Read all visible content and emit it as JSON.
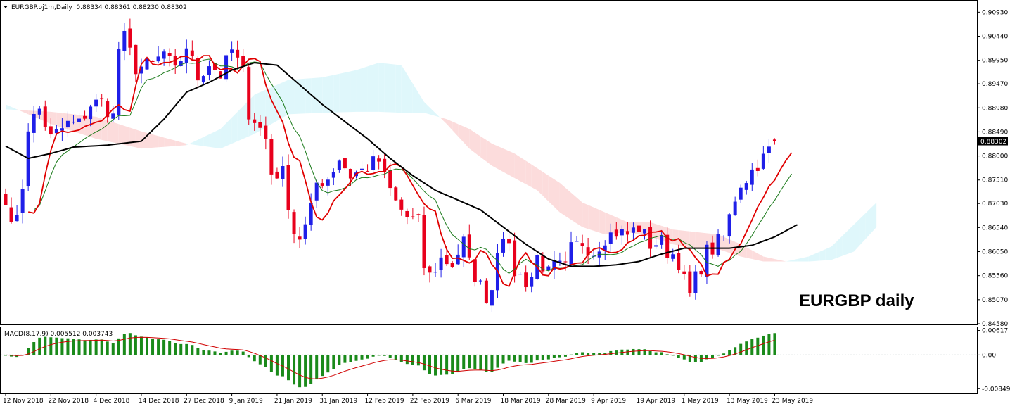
{
  "colors": {
    "bull": "#1f1fe8",
    "bear": "#e8001c",
    "ma_fast": "#e00000",
    "ma_mid": "#1a7a1a",
    "ma_slow": "#000000",
    "cloud_bull": "#dff7fb",
    "cloud_bear": "#fcdcdc",
    "macd_hist": "#1a8a1a",
    "macd_signal": "#d00000",
    "price_line": "#8a9aa8",
    "current_price_label_bg": "#000000"
  },
  "main_header": {
    "symbol_info": "EURGBP.oj1m,Daily  0.88334 0.88361 0.88230 0.88302"
  },
  "macd_header": {
    "info": "MACD(8,17,9) 0.005512 0.003743"
  },
  "annotation": {
    "text": "EURGBP daily"
  },
  "chart_data": [
    {
      "type": "candlestick",
      "title": "EURGBP.oj1m,Daily",
      "symbol": "EURGBP.oj1m",
      "timeframe": "Daily",
      "last_bar_ohlc": {
        "open": 0.88334,
        "high": 0.88361,
        "low": 0.8823,
        "close": 0.88302
      },
      "current_price": {
        "value": 0.88302,
        "label": "0.88302"
      },
      "ylim": [
        0.8458,
        0.9115
      ],
      "y_ticks": [
        {
          "value": 0.9093,
          "label": "0.90930"
        },
        {
          "value": 0.9044,
          "label": "0.90440"
        },
        {
          "value": 0.8995,
          "label": "0.89950"
        },
        {
          "value": 0.8947,
          "label": "0.89470"
        },
        {
          "value": 0.8898,
          "label": "0.88980"
        },
        {
          "value": 0.8849,
          "label": "0.88490"
        },
        {
          "value": 0.88,
          "label": "0.88000"
        },
        {
          "value": 0.8751,
          "label": "0.87510"
        },
        {
          "value": 0.8703,
          "label": "0.87030"
        },
        {
          "value": 0.8654,
          "label": "0.86540"
        },
        {
          "value": 0.8605,
          "label": "0.86050"
        },
        {
          "value": 0.8556,
          "label": "0.85560"
        },
        {
          "value": 0.8507,
          "label": "0.85070"
        },
        {
          "value": 0.8458,
          "label": "0.84580"
        }
      ],
      "x_ticks": [
        {
          "bar": 0,
          "label": "12 Nov 2018"
        },
        {
          "bar": 8,
          "label": "22 Nov 2018"
        },
        {
          "bar": 16,
          "label": "4 Dec 2018"
        },
        {
          "bar": 24,
          "label": "14 Dec 2018"
        },
        {
          "bar": 32,
          "label": "27 Dec 2018"
        },
        {
          "bar": 40,
          "label": "9 Jan 2019"
        },
        {
          "bar": 48,
          "label": "21 Jan 2019"
        },
        {
          "bar": 56,
          "label": "31 Jan 2019"
        },
        {
          "bar": 64,
          "label": "12 Feb 2019"
        },
        {
          "bar": 72,
          "label": "22 Feb 2019"
        },
        {
          "bar": 80,
          "label": "6 Mar 2019"
        },
        {
          "bar": 88,
          "label": "18 Mar 2019"
        },
        {
          "bar": 96,
          "label": "28 Mar 2019"
        },
        {
          "bar": 104,
          "label": "9 Apr 2019"
        },
        {
          "bar": 112,
          "label": "19 Apr 2019"
        },
        {
          "bar": 120,
          "label": "1 May 2019"
        },
        {
          "bar": 128,
          "label": "13 May 2019"
        },
        {
          "bar": 136,
          "label": "23 May 2019"
        }
      ],
      "close_waypoints": [
        [
          0,
          0.87
        ],
        [
          2,
          0.8665
        ],
        [
          3,
          0.874
        ],
        [
          4,
          0.886
        ],
        [
          6,
          0.8895
        ],
        [
          8,
          0.8835
        ],
        [
          11,
          0.8865
        ],
        [
          13,
          0.8865
        ],
        [
          15,
          0.8905
        ],
        [
          17,
          0.891
        ],
        [
          19,
          0.888
        ],
        [
          20,
          0.902
        ],
        [
          21,
          0.904
        ],
        [
          23,
          0.898
        ],
        [
          26,
          0.8985
        ],
        [
          28,
          0.901
        ],
        [
          30,
          0.897
        ],
        [
          32,
          0.9025
        ],
        [
          34,
          0.896
        ],
        [
          36,
          0.899
        ],
        [
          38,
          0.8965
        ],
        [
          40,
          0.9015
        ],
        [
          42,
          0.897
        ],
        [
          43,
          0.889
        ],
        [
          44,
          0.8875
        ],
        [
          46,
          0.8835
        ],
        [
          47,
          0.8765
        ],
        [
          49,
          0.8765
        ],
        [
          51,
          0.8645
        ],
        [
          52,
          0.8635
        ],
        [
          53,
          0.8655
        ],
        [
          54,
          0.869
        ],
        [
          55,
          0.8745
        ],
        [
          57,
          0.8755
        ],
        [
          59,
          0.8795
        ],
        [
          61,
          0.876
        ],
        [
          63,
          0.877
        ],
        [
          65,
          0.8785
        ],
        [
          66,
          0.879
        ],
        [
          67,
          0.8755
        ],
        [
          69,
          0.8705
        ],
        [
          71,
          0.8675
        ],
        [
          73,
          0.8665
        ],
        [
          74,
          0.8575
        ],
        [
          75,
          0.8555
        ],
        [
          77,
          0.859
        ],
        [
          79,
          0.858
        ],
        [
          81,
          0.8625
        ],
        [
          82,
          0.858
        ],
        [
          84,
          0.8535
        ],
        [
          85,
          0.8515
        ],
        [
          86,
          0.853
        ],
        [
          87,
          0.8615
        ],
        [
          88,
          0.8645
        ],
        [
          89,
          0.8605
        ],
        [
          90,
          0.8565
        ],
        [
          92,
          0.8545
        ],
        [
          93,
          0.8555
        ],
        [
          94,
          0.8595
        ],
        [
          96,
          0.856
        ],
        [
          97,
          0.8575
        ],
        [
          99,
          0.857
        ],
        [
          100,
          0.861
        ],
        [
          102,
          0.8625
        ],
        [
          104,
          0.8605
        ],
        [
          106,
          0.8635
        ],
        [
          108,
          0.8645
        ],
        [
          110,
          0.864
        ],
        [
          112,
          0.8655
        ],
        [
          114,
          0.862
        ],
        [
          116,
          0.8625
        ],
        [
          117,
          0.8605
        ],
        [
          118,
          0.86
        ],
        [
          119,
          0.8585
        ],
        [
          120,
          0.8545
        ],
        [
          121,
          0.8515
        ],
        [
          122,
          0.855
        ],
        [
          123,
          0.8575
        ],
        [
          124,
          0.8605
        ],
        [
          125,
          0.861
        ],
        [
          126,
          0.8625
        ],
        [
          127,
          0.8635
        ],
        [
          128,
          0.8675
        ],
        [
          129,
          0.8715
        ],
        [
          130,
          0.8745
        ],
        [
          131,
          0.8755
        ],
        [
          132,
          0.877
        ],
        [
          133,
          0.8785
        ],
        [
          134,
          0.8795
        ],
        [
          135,
          0.8812
        ],
        [
          136,
          0.88302
        ]
      ],
      "slow_ma_waypoints": [
        [
          0,
          0.882
        ],
        [
          4,
          0.8795
        ],
        [
          8,
          0.8805
        ],
        [
          12,
          0.8818
        ],
        [
          18,
          0.8822
        ],
        [
          24,
          0.883
        ],
        [
          28,
          0.8875
        ],
        [
          32,
          0.893
        ],
        [
          36,
          0.895
        ],
        [
          40,
          0.8975
        ],
        [
          44,
          0.899
        ],
        [
          48,
          0.8985
        ],
        [
          52,
          0.8945
        ],
        [
          56,
          0.8905
        ],
        [
          60,
          0.887
        ],
        [
          64,
          0.8835
        ],
        [
          68,
          0.8795
        ],
        [
          72,
          0.876
        ],
        [
          76,
          0.873
        ],
        [
          80,
          0.871
        ],
        [
          84,
          0.869
        ],
        [
          88,
          0.8655
        ],
        [
          92,
          0.862
        ],
        [
          96,
          0.859
        ],
        [
          100,
          0.8575
        ],
        [
          104,
          0.8575
        ],
        [
          108,
          0.8578
        ],
        [
          112,
          0.8585
        ],
        [
          116,
          0.86
        ],
        [
          120,
          0.8612
        ],
        [
          124,
          0.8612
        ],
        [
          128,
          0.8612
        ],
        [
          132,
          0.8618
        ],
        [
          136,
          0.8635
        ],
        [
          140,
          0.866
        ]
      ],
      "ichimoku_spans": {
        "span_a": [
          [
            0,
            0.8905
          ],
          [
            8,
            0.8865
          ],
          [
            16,
            0.8835
          ],
          [
            24,
            0.8815
          ],
          [
            32,
            0.8822
          ],
          [
            38,
            0.8855
          ],
          [
            44,
            0.8925
          ],
          [
            50,
            0.8955
          ],
          [
            56,
            0.896
          ],
          [
            62,
            0.8975
          ],
          [
            66,
            0.899
          ],
          [
            70,
            0.8985
          ],
          [
            74,
            0.891
          ],
          [
            78,
            0.8865
          ],
          [
            82,
            0.8815
          ],
          [
            86,
            0.878
          ],
          [
            90,
            0.8755
          ],
          [
            94,
            0.873
          ],
          [
            98,
            0.8685
          ],
          [
            102,
            0.8655
          ],
          [
            106,
            0.864
          ],
          [
            110,
            0.8645
          ],
          [
            114,
            0.8635
          ],
          [
            118,
            0.862
          ],
          [
            122,
            0.8612
          ],
          [
            126,
            0.861
          ],
          [
            130,
            0.8595
          ],
          [
            134,
            0.8585
          ],
          [
            138,
            0.8585
          ],
          [
            142,
            0.8595
          ],
          [
            146,
            0.8615
          ],
          [
            150,
            0.866
          ],
          [
            154,
            0.8705
          ]
        ],
        "span_b": [
          [
            0,
            0.8895
          ],
          [
            8,
            0.889
          ],
          [
            16,
            0.888
          ],
          [
            24,
            0.885
          ],
          [
            32,
            0.8825
          ],
          [
            38,
            0.8815
          ],
          [
            44,
            0.8845
          ],
          [
            50,
            0.8885
          ],
          [
            56,
            0.8888
          ],
          [
            62,
            0.889
          ],
          [
            66,
            0.889
          ],
          [
            70,
            0.8888
          ],
          [
            74,
            0.8888
          ],
          [
            78,
            0.8875
          ],
          [
            82,
            0.8855
          ],
          [
            86,
            0.8825
          ],
          [
            90,
            0.8805
          ],
          [
            94,
            0.8775
          ],
          [
            98,
            0.8745
          ],
          [
            102,
            0.8705
          ],
          [
            106,
            0.8685
          ],
          [
            110,
            0.8665
          ],
          [
            114,
            0.8665
          ],
          [
            118,
            0.865
          ],
          [
            122,
            0.8645
          ],
          [
            126,
            0.864
          ],
          [
            130,
            0.862
          ],
          [
            134,
            0.8595
          ],
          [
            138,
            0.8585
          ],
          [
            142,
            0.8585
          ],
          [
            146,
            0.8588
          ],
          [
            150,
            0.8605
          ],
          [
            154,
            0.8655
          ]
        ]
      }
    },
    {
      "type": "bar",
      "title": "MACD(8,17,9)",
      "indicator": "MACD(8,17,9)",
      "macd_value": 0.005512,
      "signal_value": 0.003743,
      "ylim": [
        -0.0095,
        0.0068
      ],
      "y_ticks": [
        {
          "value": 0.00617,
          "label": "0.00617"
        },
        {
          "value": 0.0,
          "label": "0.00"
        },
        {
          "value": -0.00849,
          "label": "-0.00849"
        }
      ],
      "zero_line": 0.0
    }
  ]
}
